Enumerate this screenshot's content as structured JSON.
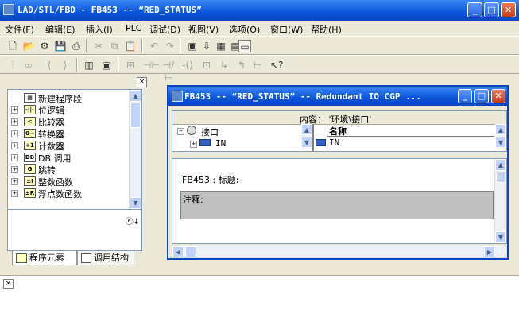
{
  "window": {
    "title": "LAD/STL/FBD  - FB453 -- “RED_STATUS”",
    "btn_min": "_",
    "btn_max": "□",
    "btn_close": "✕"
  },
  "menu": [
    "文件(F)",
    "编辑(E)",
    "插入(I)",
    "PLC",
    "调试(D)",
    "视图(V)",
    "选项(O)",
    "窗口(W)",
    "帮助(H)"
  ],
  "left_panel": {
    "close": "×",
    "tree": [
      {
        "icon": "network-icon",
        "label": "新建程序段",
        "expander": false
      },
      {
        "icon": "bit-logic-icon",
        "glyph": "-||-",
        "label": "位逻辑",
        "expander": true
      },
      {
        "icon": "compare-icon",
        "glyph": "<",
        "label": "比较器",
        "expander": true
      },
      {
        "icon": "convert-icon",
        "glyph": "0→",
        "label": "转换器",
        "expander": true
      },
      {
        "icon": "counter-icon",
        "glyph": "+1",
        "label": "计数器",
        "expander": true
      },
      {
        "icon": "db-call-icon",
        "glyph": "DB",
        "label": "DB 调用",
        "expander": true
      },
      {
        "icon": "jump-icon",
        "glyph": "G",
        "label": "跳转",
        "expander": true
      },
      {
        "icon": "integer-icon",
        "glyph": "±I",
        "label": "整数函数",
        "expander": true
      },
      {
        "icon": "float-icon",
        "glyph": "±R",
        "label": "浮点数函数",
        "expander": true
      }
    ],
    "tabs": [
      "程序元素",
      "调用结构"
    ]
  },
  "editor": {
    "title": "FB453 -- “RED_STATUS” -- Redundant IO CGP ...",
    "content_label": "内容：  '环境\\接口'",
    "interface_label": "接口",
    "in_label": "IN",
    "name_header": "名称",
    "in_value": "IN",
    "block_title": "FB453 : 标题:",
    "comment_label": "注释:"
  }
}
